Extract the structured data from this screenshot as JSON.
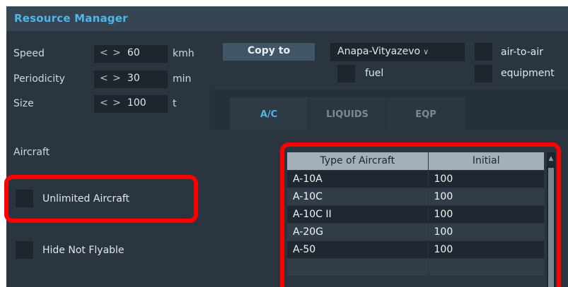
{
  "window": {
    "title": "Resource Manager"
  },
  "params": [
    {
      "label": "Speed",
      "value": "60",
      "unit": "kmh"
    },
    {
      "label": "Periodicity",
      "value": "30",
      "unit": "min"
    },
    {
      "label": "Size",
      "value": "100",
      "unit": "t"
    }
  ],
  "spin_arrows": "< >",
  "toolbar": {
    "copy_label": "Copy to",
    "airfield_selected": "Anapa-Vityazevo",
    "checkboxes": {
      "air_to_air": "air-to-air",
      "fuel": "fuel",
      "equipment": "equipment"
    }
  },
  "tabs": [
    {
      "label": "A/C",
      "active": true
    },
    {
      "label": "LIQUIDS",
      "active": false
    },
    {
      "label": "EQP",
      "active": false
    }
  ],
  "aircraft": {
    "section_label": "Aircraft",
    "unlimited_label": "Unlimited Aircraft",
    "hide_not_flyable_label": "Hide Not Flyable",
    "columns": [
      "Type of Aircraft",
      "Initial"
    ],
    "rows": [
      {
        "type": "A-10A",
        "initial": "100"
      },
      {
        "type": "A-10C",
        "initial": "100"
      },
      {
        "type": "A-10C II",
        "initial": "100"
      },
      {
        "type": "A-20G",
        "initial": "100"
      },
      {
        "type": "A-50",
        "initial": "100"
      },
      {
        "type": "",
        "initial": ""
      }
    ]
  },
  "colors": {
    "accent": "#4fb6e6",
    "highlight": "#ff0000",
    "background": "#2a3540"
  }
}
